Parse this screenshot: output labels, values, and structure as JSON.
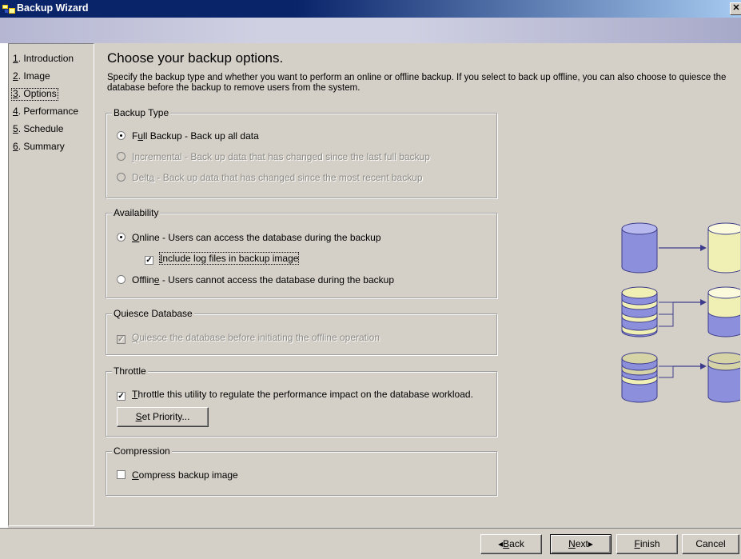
{
  "window": {
    "title": "Backup Wizard",
    "close_glyph": "✕"
  },
  "nav": {
    "items": [
      {
        "num": "1",
        "label": ". Introduction"
      },
      {
        "num": "2",
        "label": ". Image"
      },
      {
        "num": "3",
        "label": ". Options"
      },
      {
        "num": "4",
        "label": ". Performance"
      },
      {
        "num": "5",
        "label": ". Schedule"
      },
      {
        "num": "6",
        "label": ". Summary"
      }
    ],
    "selected_index": 2
  },
  "page": {
    "heading": "Choose your backup options.",
    "description": "Specify the backup type and whether you want to perform an online or offline backup. If you select to back up offline, you can also choose to quiesce the database before the backup to remove users from the system."
  },
  "backup_type": {
    "legend": "Backup Type",
    "full": {
      "mnemonic": "u",
      "pre": "F",
      "post": "ll Backup  -  Back up all data",
      "checked": true,
      "enabled": true
    },
    "incremental": {
      "mnemonic": "I",
      "pre": "",
      "post": "ncremental  -  Back up data that has changed since the last full backup",
      "checked": false,
      "enabled": false
    },
    "delta": {
      "mnemonic": "a",
      "pre": "Delt",
      "post": "  -  Back up data that has changed since the most recent backup",
      "checked": false,
      "enabled": false
    }
  },
  "availability": {
    "legend": "Availability",
    "online": {
      "mnemonic": "O",
      "pre": "",
      "post": "nline  -  Users can access the database during the backup",
      "checked": true
    },
    "include_logs": {
      "mnemonic": "I",
      "pre": "",
      "post": "nclude log files in backup image",
      "checked": true
    },
    "offline": {
      "mnemonic": "e",
      "pre": "Offlin",
      "post": "  -  Users cannot access the database during the backup",
      "checked": false
    }
  },
  "quiesce": {
    "legend": "Quiesce Database",
    "option": {
      "mnemonic": "Q",
      "pre": "",
      "post": "uiesce the database before initiating the offline operation",
      "checked": true,
      "enabled": false
    }
  },
  "throttle": {
    "legend": "Throttle",
    "option": {
      "mnemonic": "T",
      "pre": "",
      "post": "hrottle this utility to regulate the performance impact on the database workload.",
      "checked": true
    },
    "set_priority": {
      "mnemonic": "S",
      "pre": "",
      "post": "et Priority..."
    }
  },
  "compression": {
    "legend": "Compression",
    "option": {
      "mnemonic": "C",
      "pre": "",
      "post": "ompress backup image",
      "checked": false
    }
  },
  "buttons": {
    "back": {
      "arrow": "◂",
      "mnemonic": "B",
      "post": "ack"
    },
    "next": {
      "mnemonic": "N",
      "post": "ext",
      "arrow": "▸"
    },
    "finish": {
      "mnemonic": "F",
      "post": "inish"
    },
    "cancel": {
      "label": "Cancel"
    }
  },
  "check_glyph": "✓",
  "colors": {
    "title_bar": "#0a246a",
    "face": "#d4d0c8",
    "banner": "#cfd0e2",
    "db_blue": "#8c8fdb",
    "db_yellow": "#f1f0b4",
    "db_olive": "#d6d4a6",
    "arrow": "#3c3c8a"
  },
  "icons": [
    "app-icon",
    "close-icon",
    "database-full-diagram",
    "database-incremental-diagram",
    "database-delta-diagram"
  ]
}
